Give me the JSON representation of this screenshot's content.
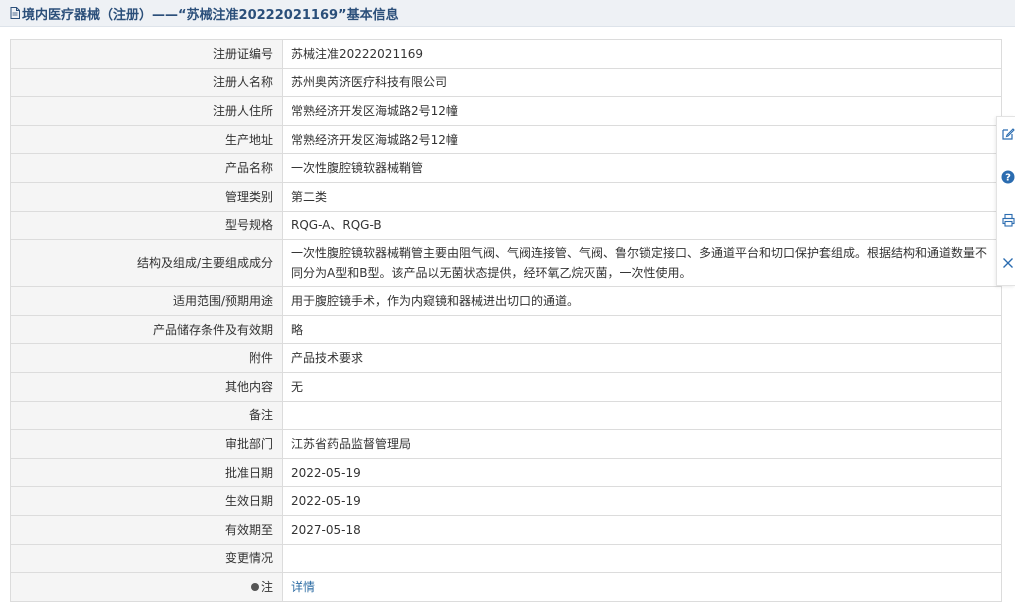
{
  "header": {
    "title": "境内医疗器械（注册）——“苏械注准20222021169”基本信息",
    "icon": "document-icon"
  },
  "rows": [
    {
      "label": "注册证编号",
      "value": "苏械注准20222021169"
    },
    {
      "label": "注册人名称",
      "value": "苏州奥芮济医疗科技有限公司"
    },
    {
      "label": "注册人住所",
      "value": "常熟经济开发区海城路2号12幢"
    },
    {
      "label": "生产地址",
      "value": "常熟经济开发区海城路2号12幢"
    },
    {
      "label": "产品名称",
      "value": "一次性腹腔镜软器械鞘管"
    },
    {
      "label": "管理类别",
      "value": "第二类"
    },
    {
      "label": "型号规格",
      "value": "RQG-A、RQG-B"
    },
    {
      "label": "结构及组成/主要组成成分",
      "value": "一次性腹腔镜软器械鞘管主要由阻气阀、气阀连接管、气阀、鲁尔锁定接口、多通道平台和切口保护套组成。根据结构和通道数量不同分为A型和B型。该产品以无菌状态提供，经环氧乙烷灭菌，一次性使用。"
    },
    {
      "label": "适用范围/预期用途",
      "value": "用于腹腔镜手术，作为内窥镜和器械进出切口的通道。"
    },
    {
      "label": "产品储存条件及有效期",
      "value": "略"
    },
    {
      "label": "附件",
      "value": "产品技术要求"
    },
    {
      "label": "其他内容",
      "value": "无"
    },
    {
      "label": "备注",
      "value": ""
    },
    {
      "label": "审批部门",
      "value": "江苏省药品监督管理局"
    },
    {
      "label": "批准日期",
      "value": "2022-05-19"
    },
    {
      "label": "生效日期",
      "value": "2022-05-19"
    },
    {
      "label": "有效期至",
      "value": "2027-05-18"
    },
    {
      "label": "变更情况",
      "value": ""
    },
    {
      "label": "注",
      "value": "详情"
    }
  ],
  "side_toolbar": {
    "icons": [
      "edit-icon",
      "help-icon",
      "print-icon",
      "close-icon"
    ]
  },
  "colors": {
    "header_bg": "#eef1f5",
    "title_text": "#2b4f7a",
    "label_bg": "#f5f5f5",
    "border": "#dcdcdc",
    "link": "#2e6da4",
    "toolbar_icon": "#2b6cb0"
  }
}
